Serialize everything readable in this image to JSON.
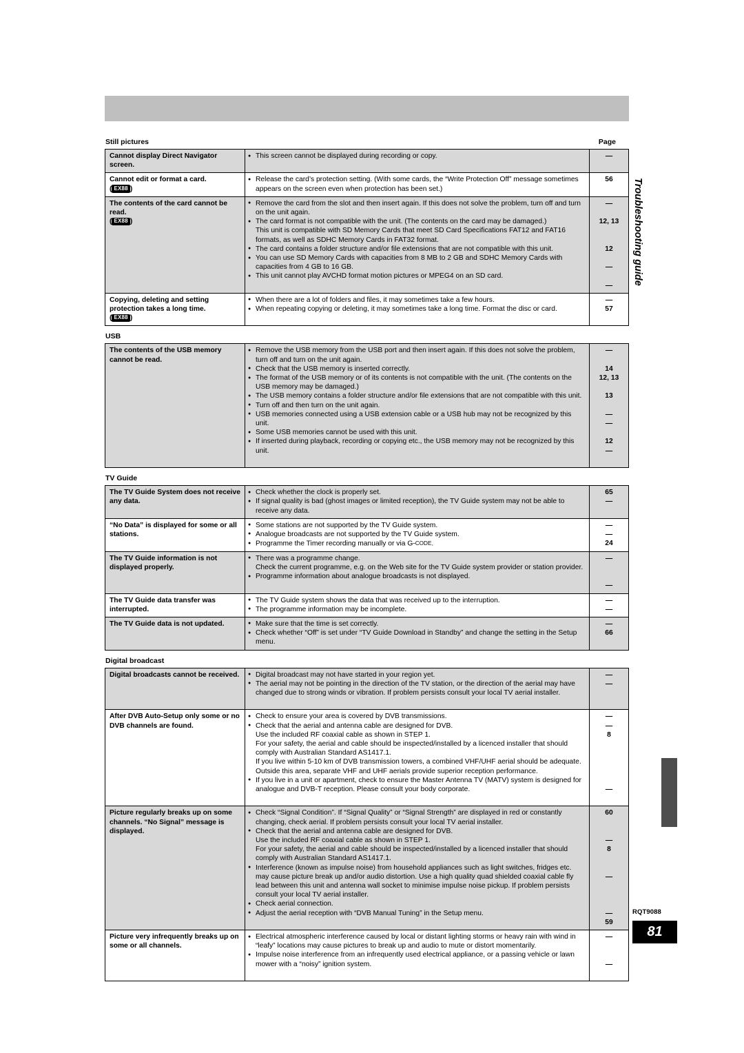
{
  "header": {
    "banner_label": ""
  },
  "side_tab": {
    "label": "Troubleshooting guide"
  },
  "footer": {
    "document_code": "RQT9088",
    "page_number": "81"
  },
  "page_column_header": "Page",
  "badge_label": "EX88",
  "sections": [
    {
      "title": "Still pictures",
      "show_page_header": true,
      "rows": [
        {
          "shaded": true,
          "symptom": "Cannot display Direct Navigator screen.",
          "badge": false,
          "remedies": [
            {
              "text": "This screen cannot be displayed during recording or copy.",
              "page": "—"
            }
          ]
        },
        {
          "shaded": false,
          "symptom": "Cannot edit or format a card.",
          "badge": true,
          "remedies": [
            {
              "text": "Release the card’s protection setting. (With some cards, the “Write Protection Off” message sometimes appears on the screen even when protection has been set.)",
              "page": "56"
            }
          ]
        },
        {
          "shaded": true,
          "symptom": "The contents of the card cannot be read.",
          "badge": true,
          "remedies": [
            {
              "text": "Remove the card from the slot and then insert again. If this does not solve the problem, turn off and turn on the unit again.",
              "page": "—"
            },
            {
              "text": "The card format is not compatible with the unit. (The contents on the card may be damaged.)",
              "sub": "This unit is compatible with SD Memory Cards that meet SD Card Specifications FAT12 and FAT16 formats, as well as SDHC Memory Cards in FAT32 format.",
              "page": "12, 13"
            },
            {
              "text": "The card contains a folder structure and/or file extensions that are not compatible with this unit.",
              "page": "12"
            },
            {
              "text": "You can use SD Memory Cards with capacities from 8 MB to 2 GB and SDHC Memory Cards with capacities from 4 GB to 16 GB.",
              "page": "—"
            },
            {
              "text": "This unit cannot play AVCHD format motion pictures or MPEG4 on an SD card.",
              "page": "—"
            }
          ]
        },
        {
          "shaded": false,
          "symptom": "Copying, deleting and setting protection takes a long time.",
          "badge": true,
          "remedies": [
            {
              "text": "When there are a lot of folders and files, it may sometimes take a few hours.",
              "page": "—"
            },
            {
              "text": "When repeating copying or deleting, it may sometimes take a long time. Format the disc or card.",
              "page": "57"
            }
          ]
        }
      ]
    },
    {
      "title": "USB",
      "show_page_header": false,
      "rows": [
        {
          "shaded": true,
          "symptom": "The contents of the USB memory cannot be read.",
          "badge": false,
          "remedies": [
            {
              "text": "Remove the USB memory from the USB port and then insert again. If this does not solve the problem, turn off and turn on the unit again.",
              "page": "—"
            },
            {
              "text": "Check that the USB memory is inserted correctly.",
              "page": "14"
            },
            {
              "text": "The format of the USB memory or of its contents is not compatible with the unit. (The contents on the USB memory may be damaged.)",
              "page": "12, 13"
            },
            {
              "text": "The USB memory contains a folder structure and/or file extensions that are not compatible with this unit.",
              "page": "13"
            },
            {
              "text": "Turn off and then turn on the unit again.",
              "page": "—"
            },
            {
              "text": "USB memories connected using a USB extension cable or a USB hub may not be recognized by this unit.",
              "page": "—"
            },
            {
              "text": "Some USB memories cannot be used with this unit.",
              "page": "12"
            },
            {
              "text": "If inserted during playback, recording or copying etc., the USB memory may not be recognized by this unit.",
              "page": "—"
            }
          ]
        }
      ]
    },
    {
      "title": "TV Guide",
      "show_page_header": false,
      "rows": [
        {
          "shaded": true,
          "symptom": "The TV Guide System does not receive any data.",
          "badge": false,
          "remedies": [
            {
              "text": "Check whether the clock is properly set.",
              "page": "65"
            },
            {
              "text": "If signal quality is bad (ghost images or limited reception), the TV Guide system may not be able to receive any data.",
              "page": "—"
            }
          ]
        },
        {
          "shaded": false,
          "symptom": "“No Data” is displayed for some or all stations.",
          "badge": false,
          "remedies": [
            {
              "text": "Some stations are not supported by the TV Guide system.",
              "page": "—"
            },
            {
              "text": "Analogue broadcasts are not supported by the TV Guide system.",
              "page": "—"
            },
            {
              "text": "Programme the Timer recording manually or via G-CODE.",
              "gcode": true,
              "page": "24"
            }
          ]
        },
        {
          "shaded": true,
          "symptom": "The TV Guide information is not displayed properly.",
          "badge": false,
          "remedies": [
            {
              "text": "There was a programme change.",
              "sub": "Check the current programme, e.g. on the Web site for the TV Guide system provider or station provider.",
              "page": "—"
            },
            {
              "text": "Programme information about analogue broadcasts is not displayed.",
              "page": "—"
            }
          ]
        },
        {
          "shaded": false,
          "symptom": "The TV Guide data transfer was interrupted.",
          "badge": false,
          "remedies": [
            {
              "text": "The TV Guide system shows the data that was received up to the interruption.",
              "page": "—"
            },
            {
              "text": "The programme information may be incomplete.",
              "page": "—"
            }
          ]
        },
        {
          "shaded": true,
          "symptom": "The TV Guide data is not updated.",
          "badge": false,
          "remedies": [
            {
              "text": "Make sure that the time is set correctly.",
              "page": "—"
            },
            {
              "text": "Check whether “Off” is set under “TV Guide Download in Standby” and change the setting in the Setup menu.",
              "page": "66"
            }
          ]
        }
      ]
    },
    {
      "title": "Digital broadcast",
      "show_page_header": false,
      "rows": [
        {
          "shaded": true,
          "symptom": "Digital broadcasts cannot be received.",
          "badge": false,
          "remedies": [
            {
              "text": "Digital broadcast may not have started in your region yet.",
              "page": "—"
            },
            {
              "text": "The aerial may not be pointing in the direction of the TV station, or the direction of the aerial may have changed due to strong winds or vibration. If problem persists consult your local TV aerial installer.",
              "page": "—"
            }
          ]
        },
        {
          "shaded": false,
          "symptom": "After DVB Auto-Setup only some or no DVB channels are found.",
          "badge": false,
          "remedies": [
            {
              "text": "Check to ensure your area is covered by DVB transmissions.",
              "page": "—"
            },
            {
              "text": "Check that the aerial and antenna cable are designed for DVB.",
              "sub": "Use the included RF coaxial cable as shown in STEP 1.\nFor your safety, the aerial and cable should be inspected/installed by a licenced installer that should comply with Australian Standard AS1417.1.\nIf you live within 5-10 km of DVB transmission towers, a combined VHF/UHF aerial should be adequate. Outside this area, separate VHF and UHF aerials provide superior reception performance.",
              "page": "—\n8"
            },
            {
              "text": "If you live in a unit or apartment, check to ensure the Master Antenna TV (MATV) system is designed for analogue and DVB-T reception. Please consult your body corporate.",
              "page": "—"
            }
          ]
        },
        {
          "shaded": true,
          "symptom": "Picture regularly breaks up on some channels. “No Signal” message is displayed.",
          "badge": false,
          "remedies": [
            {
              "text": "Check “Signal Condition”. If “Signal Quality” or “Signal Strength” are displayed in red or constantly changing, check aerial. If problem persists consult your local TV aerial installer.",
              "page": "60"
            },
            {
              "text": "Check that the aerial and antenna cable are designed for DVB.",
              "sub": "Use the included RF coaxial cable as shown in STEP 1.\nFor your safety, the aerial and cable should be inspected/installed by a licenced installer that should comply with Australian Standard AS1417.1.",
              "page": "—\n8"
            },
            {
              "text": "Interference (known as impulse noise) from household appliances such as light switches, fridges etc. may cause picture break up and/or audio distortion. Use a high quality quad shielded coaxial cable fly lead between this unit and antenna wall socket to minimise impulse noise pickup. If problem persists consult your local TV aerial installer.",
              "page": "—"
            },
            {
              "text": "Check aerial connection.",
              "page": "—"
            },
            {
              "text": "Adjust the aerial reception with “DVB Manual Tuning” in the Setup menu.",
              "page": "59"
            }
          ]
        },
        {
          "shaded": false,
          "symptom": "Picture very infrequently breaks up on some or all channels.",
          "badge": false,
          "remedies": [
            {
              "text": "Electrical atmospheric interference caused by local or distant lighting storms or heavy rain with wind in “leafy” locations may cause pictures to break up and audio to mute or distort momentarily.",
              "page": "—"
            },
            {
              "text": "Impulse noise interference from an infrequently used electrical appliance, or a passing vehicle or lawn mower with a “noisy” ignition system.",
              "page": "—"
            }
          ]
        }
      ]
    }
  ]
}
